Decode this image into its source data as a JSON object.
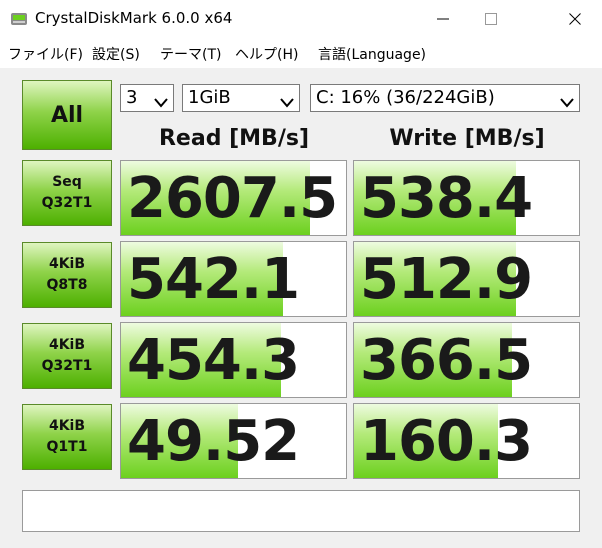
{
  "window": {
    "title": "CrystalDiskMark 6.0.0 x64"
  },
  "menu": {
    "items": [
      "ファイル(F)",
      "設定(S)",
      "テーマ(T)",
      "ヘルプ(H)",
      "言語(Language)"
    ]
  },
  "controls": {
    "all_label": "All",
    "count_value": "3",
    "size_value": "1GiB",
    "drive_value": "C: 16% (36/224GiB)"
  },
  "headers": {
    "read": "Read [MB/s]",
    "write": "Write [MB/s]"
  },
  "tests": [
    {
      "line1": "Seq",
      "line2": "Q32T1",
      "read": "2607.5",
      "write": "538.4",
      "read_level": 0.84,
      "write_level": 0.72
    },
    {
      "line1": "4KiB",
      "line2": "Q8T8",
      "read": "542.1",
      "write": "512.9",
      "read_level": 0.72,
      "write_level": 0.72
    },
    {
      "line1": "4KiB",
      "line2": "Q32T1",
      "read": "454.3",
      "write": "366.5",
      "read_level": 0.71,
      "write_level": 0.7
    },
    {
      "line1": "4KiB",
      "line2": "Q1T1",
      "read": "49.52",
      "write": "160.3",
      "read_level": 0.52,
      "write_level": 0.64
    }
  ],
  "comment": "",
  "colors": {
    "accent_green": "#6cd01e",
    "button_green": "#4db000"
  }
}
